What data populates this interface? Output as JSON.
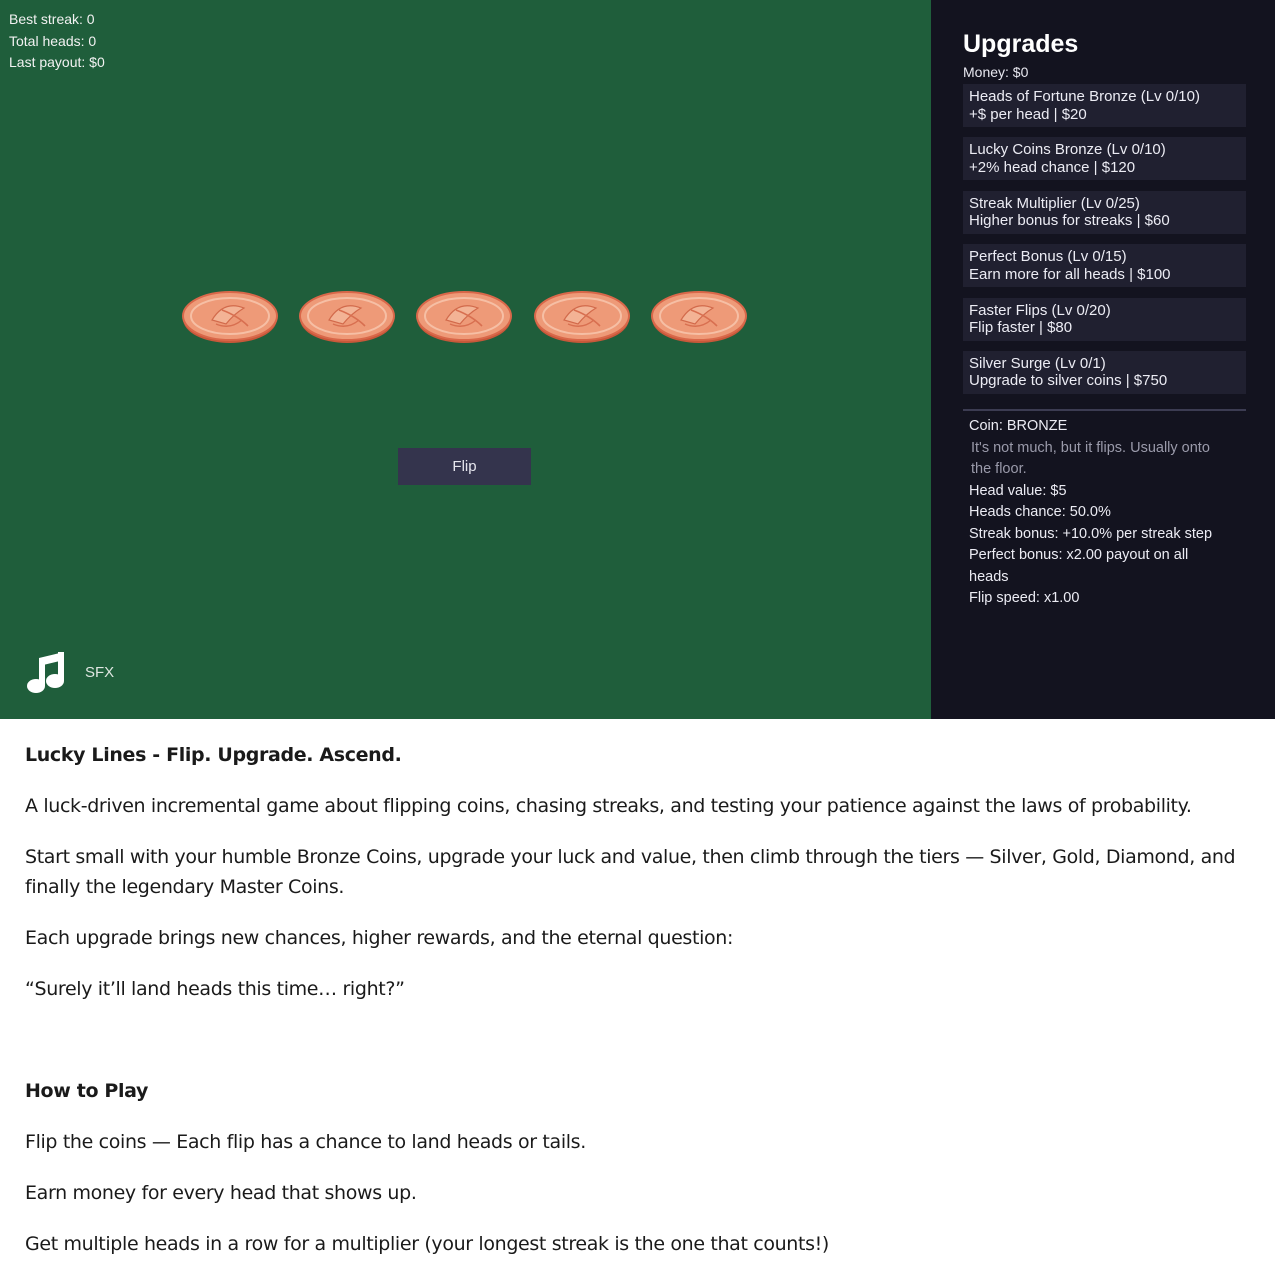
{
  "stats": {
    "best_streak": "Best streak: 0",
    "total_heads": "Total heads: 0",
    "last_payout": "Last payout: $0"
  },
  "coins": [
    "coin",
    "coin",
    "coin",
    "coin",
    "coin"
  ],
  "flip_label": "Flip",
  "sfx_label": "SFX",
  "icons": {
    "music": "music-note-icon"
  },
  "colors": {
    "board": "#1f5e3b",
    "panel": "#13131f",
    "button": "#34344d",
    "coin_fill": "#ee9a78"
  },
  "upgrades": {
    "title": "Upgrades",
    "money": "Money: $0",
    "items": [
      {
        "line1": "Heads of Fortune Bronze (Lv 0/10)",
        "line2": "+$ per head  |  $20"
      },
      {
        "line1": "Lucky Coins Bronze (Lv 0/10)",
        "line2": "+2% head chance  |  $120"
      },
      {
        "line1": "Streak Multiplier (Lv 0/25)",
        "line2": "Higher bonus for streaks  |  $60"
      },
      {
        "line1": "Perfect Bonus (Lv 0/15)",
        "line2": "Earn more for all heads  |  $100"
      },
      {
        "line1": "Faster Flips (Lv 0/20)",
        "line2": "Flip faster  |  $80"
      },
      {
        "line1": "Silver Surge (Lv 0/1)",
        "line2": "Upgrade to silver coins  |  $750"
      }
    ]
  },
  "coin_info": {
    "coin": "Coin: BRONZE",
    "flavor_1": "It's not much, but it flips. Usually onto",
    "flavor_2": "the floor.",
    "head_value": "Head value: $5",
    "heads_chance": "Heads chance: 50.0%",
    "streak_bonus": "Streak bonus: +10.0% per streak step",
    "perfect_bonus_1": "Perfect bonus: x2.00 payout on all",
    "perfect_bonus_2": "heads",
    "flip_speed": "Flip speed: x1.00"
  },
  "description": {
    "title": "Lucky Lines - Flip. Upgrade. Ascend.",
    "p1": "A luck-driven incremental game about flipping coins, chasing streaks, and testing your patience against the laws of probability.",
    "p2": "Start small with your humble Bronze Coins, upgrade your luck and value, then climb through the tiers — Silver, Gold, Diamond, and finally the legendary Master Coins.",
    "p3": "Each upgrade brings new chances, higher rewards, and the eternal question:",
    "p4": "“Surely it’ll land heads this time… right?”",
    "how_title": "How to Play",
    "h1": "Flip the coins — Each flip has a chance to land heads or tails.",
    "h2": "Earn money for every head that shows up.",
    "h3": "Get multiple heads in a row for a multiplier (your longest streak is the one that counts!)"
  }
}
